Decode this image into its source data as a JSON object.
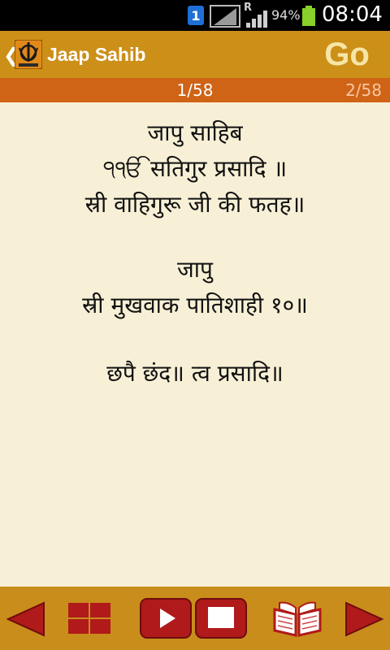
{
  "status_bar": {
    "notification_count": "1",
    "roaming": "R",
    "battery_percent": "94%",
    "time": "08:04"
  },
  "header": {
    "title": "Jaap Sahib",
    "go_label": "Go"
  },
  "page_indicator": {
    "current": "1/58",
    "next": "2/58"
  },
  "verses": [
    [
      "जापु साहिब",
      "੧ੴ सतिगुर प्रसादि ॥",
      "स्री वाहिगुरू जी की फतह॥"
    ],
    [
      "जापु",
      "स्री मुखवाक पातिशाही १०॥"
    ],
    [
      "छपै छंद॥ त्व प्रसादि॥"
    ]
  ],
  "toolbar": {
    "items": [
      "previous-page",
      "grid-view",
      "play",
      "stop",
      "open-book",
      "next-page"
    ]
  },
  "colors": {
    "title_bar": "#cc8f18",
    "page_bar": "#cf6316",
    "content_bg": "#f7f0d6",
    "toolbar": "#c98d1c",
    "control_red": "#b01a1a"
  }
}
